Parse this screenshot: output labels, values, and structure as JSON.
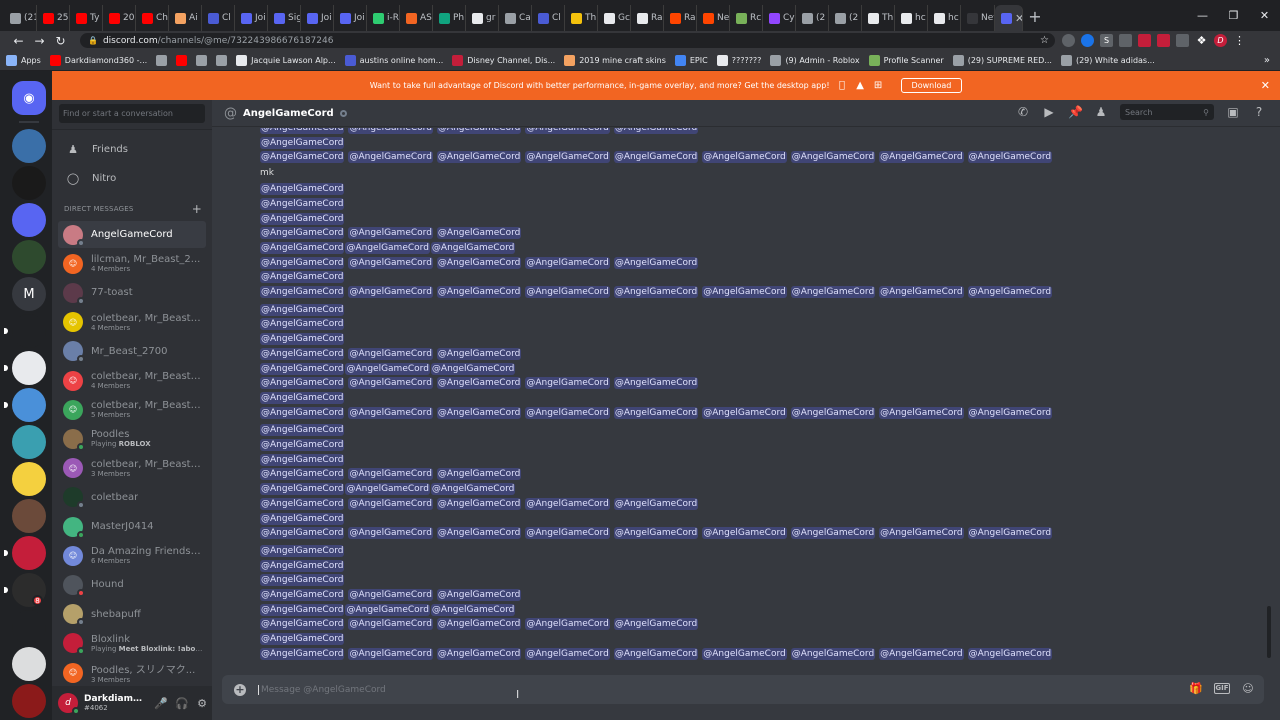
{
  "browser": {
    "tabs": [
      {
        "label": "(21",
        "color": "#9aa0a6"
      },
      {
        "label": "25",
        "color": "#ff0000"
      },
      {
        "label": "Ty",
        "color": "#ff0000"
      },
      {
        "label": "20",
        "color": "#ff0000"
      },
      {
        "label": "Ch",
        "color": "#ff0000"
      },
      {
        "label": "Ai",
        "color": "#f4a261"
      },
      {
        "label": "Cl",
        "color": "#4a5bd4"
      },
      {
        "label": "Joi",
        "color": "#5865f2"
      },
      {
        "label": "Sig",
        "color": "#5865f2"
      },
      {
        "label": "Joi",
        "color": "#5865f2"
      },
      {
        "label": "Joi",
        "color": "#5865f2"
      },
      {
        "label": "i-R",
        "color": "#2ecc71"
      },
      {
        "label": "AS",
        "color": "#f26522"
      },
      {
        "label": "Ph",
        "color": "#10a37f"
      },
      {
        "label": "gr",
        "color": "#e8eaed"
      },
      {
        "label": "Ca",
        "color": "#9aa0a6"
      },
      {
        "label": "Cl",
        "color": "#4a5bd4"
      },
      {
        "label": "Th",
        "color": "#f4c20d"
      },
      {
        "label": "Gc",
        "color": "#e8eaed"
      },
      {
        "label": "Ra",
        "color": "#e8eaed"
      },
      {
        "label": "Ra",
        "color": "#ff4500"
      },
      {
        "label": "Ne",
        "color": "#ff4500"
      },
      {
        "label": "Rc",
        "color": "#78b159"
      },
      {
        "label": "Cy",
        "color": "#9146ff"
      },
      {
        "label": "(2",
        "color": "#9aa0a6"
      },
      {
        "label": "(2",
        "color": "#9aa0a6"
      },
      {
        "label": "Th",
        "color": "#e8eaed"
      },
      {
        "label": "hc",
        "color": "#e8eaed"
      },
      {
        "label": "hc",
        "color": "#e8eaed"
      },
      {
        "label": "New T",
        "color": "#35363a"
      }
    ],
    "active_tab_color": "#5865f2",
    "url_host": "discord.com",
    "url_path": "/channels/@me/732243986676187246",
    "bookmarks": [
      {
        "label": "Apps",
        "color": "#8ab4f8"
      },
      {
        "label": "Darkdiamond360 -...",
        "color": "#ff0000"
      },
      {
        "label": "",
        "color": "#9aa0a6"
      },
      {
        "label": "",
        "color": "#ff0000"
      },
      {
        "label": "",
        "color": "#9aa0a6"
      },
      {
        "label": "",
        "color": "#9aa0a6"
      },
      {
        "label": "Jacquie Lawson Alp...",
        "color": "#e8eaed"
      },
      {
        "label": "austins online hom...",
        "color": "#4a5bd4"
      },
      {
        "label": "Disney Channel, Dis...",
        "color": "#c41e3a"
      },
      {
        "label": "2019 mine craft skins",
        "color": "#f4a261"
      },
      {
        "label": "EPIC",
        "color": "#4285f4"
      },
      {
        "label": "???????",
        "color": "#e8eaed"
      },
      {
        "label": "(9) Admin - Roblox",
        "color": "#9aa0a6"
      },
      {
        "label": "Profile Scanner",
        "color": "#78b159"
      },
      {
        "label": "(29) SUPREME RED...",
        "color": "#9aa0a6"
      },
      {
        "label": "(29) White adidas...",
        "color": "#9aa0a6"
      }
    ]
  },
  "banner": {
    "text": "Want to take full advantage of Discord with better performance, in-game overlay, and more? Get the desktop app!",
    "download_label": "Download",
    "color": "#f26522"
  },
  "sidebar": {
    "search_placeholder": "Find or start a conversation",
    "friends_label": "Friends",
    "nitro_label": "Nitro",
    "dm_header": "DIRECT MESSAGES",
    "dms": [
      {
        "name": "AngelGameCord",
        "sub": "",
        "avatar_color": "#c97b84",
        "status": "#747f8d",
        "selected": true
      },
      {
        "name": "lilcman, Mr_Beast_2...",
        "sub": "4 Members",
        "avatar_color": "#f26522",
        "status": "",
        "selected": false
      },
      {
        "name": "77-toast",
        "sub": "",
        "avatar_color": "#5c3a4a",
        "status": "#747f8d",
        "selected": false
      },
      {
        "name": "coletbear, Mr_Beast_...",
        "sub": "4 Members",
        "avatar_color": "#e5c400",
        "status": "",
        "selected": false
      },
      {
        "name": "Mr_Beast_2700",
        "sub": "",
        "avatar_color": "#6a7fa8",
        "status": "#747f8d",
        "selected": false
      },
      {
        "name": "coletbear, Mr_Beast_...",
        "sub": "4 Members",
        "avatar_color": "#ed4245",
        "status": "",
        "selected": false
      },
      {
        "name": "coletbear, Mr_Beast_...",
        "sub": "5 Members",
        "avatar_color": "#3ba55c",
        "status": "",
        "selected": false
      },
      {
        "name": "Poodles",
        "sub_prefix": "Playing ",
        "sub_bold": "ROBLOX",
        "avatar_color": "#8a6d4a",
        "status": "#3ba55c",
        "selected": false
      },
      {
        "name": "coletbear, Mr_Beast_...",
        "sub": "3 Members",
        "avatar_color": "#9b59b6",
        "status": "",
        "selected": false
      },
      {
        "name": "coletbear",
        "sub": "",
        "avatar_color": "#1e3b2a",
        "status": "#747f8d",
        "selected": false
      },
      {
        "name": "MasterJ0414",
        "sub": "",
        "avatar_color": "#43b581",
        "status": "#3ba55c",
        "selected": false
      },
      {
        "name": "Da Amazing Friends ...",
        "sub": "6 Members",
        "avatar_color": "#7289da",
        "status": "",
        "selected": false
      },
      {
        "name": "Hound",
        "sub": "",
        "avatar_color": "#4f545c",
        "status": "#ed4245",
        "selected": false
      },
      {
        "name": "shebapuff",
        "sub": "",
        "avatar_color": "#b5a06a",
        "status": "#747f8d",
        "selected": false
      },
      {
        "name": "Bloxlink",
        "sub_prefix": "Playing ",
        "sub_bold": "Meet Bloxlink: !about",
        "avatar_color": "#c41e3a",
        "status": "#3ba55c",
        "selected": false
      },
      {
        "name": "Poodles, スリノマク...",
        "sub": "3 Members",
        "avatar_color": "#f26522",
        "status": "",
        "selected": false
      }
    ]
  },
  "user": {
    "name": "Darkdiamon...",
    "tag": "#4062"
  },
  "servers": [
    {
      "label": "",
      "color": "#5865f2"
    },
    {
      "label": "",
      "color": "#3a6fa8"
    },
    {
      "label": "",
      "color": "#1a1a1a"
    },
    {
      "label": "",
      "color": "#5865f2"
    },
    {
      "label": "",
      "color": "#2e4a2e"
    },
    {
      "label": "M",
      "color": "#36393f"
    },
    {
      "label": "",
      "color": "#202225"
    },
    {
      "label": "",
      "color": "#e8eaed"
    },
    {
      "label": "",
      "color": "#4a90d9"
    },
    {
      "label": "",
      "color": "#3a9fb0"
    },
    {
      "label": "",
      "color": "#f4d03f"
    },
    {
      "label": "",
      "color": "#6b4a3a"
    },
    {
      "label": "",
      "color": "#c41e3a"
    },
    {
      "label": "",
      "color": "#2c2c2c"
    },
    {
      "label": "",
      "color": "#202225"
    },
    {
      "label": "",
      "color": "#dcddde"
    },
    {
      "label": "",
      "color": "#8b1a1a"
    }
  ],
  "server_badge": "8",
  "chat": {
    "recipient": "AngelGameCord",
    "search_placeholder": "Search",
    "mention_text": "@AngelGameCord",
    "plain_text": "mk",
    "message_placeholder": "Message @AngelGameCord",
    "lines": [
      {
        "type": "mention",
        "count": 5
      },
      {
        "type": "mention",
        "count": 1
      },
      {
        "type": "mention",
        "count": 9
      },
      {
        "type": "plain"
      },
      {
        "type": "mention",
        "count": 1
      },
      {
        "type": "mention",
        "count": 1
      },
      {
        "type": "mention",
        "count": 1
      },
      {
        "type": "mention",
        "count": 3
      },
      {
        "type": "mention",
        "count": 3,
        "tight": true
      },
      {
        "type": "mention",
        "count": 5
      },
      {
        "type": "mention",
        "count": 1
      },
      {
        "type": "mention",
        "count": 9
      },
      {
        "type": "gap"
      },
      {
        "type": "mention",
        "count": 1
      },
      {
        "type": "mention",
        "count": 1
      },
      {
        "type": "mention",
        "count": 1
      },
      {
        "type": "mention",
        "count": 3
      },
      {
        "type": "mention",
        "count": 3,
        "tight": true
      },
      {
        "type": "mention",
        "count": 5
      },
      {
        "type": "mention",
        "count": 1
      },
      {
        "type": "mention",
        "count": 9
      },
      {
        "type": "gap"
      },
      {
        "type": "mention",
        "count": 1
      },
      {
        "type": "mention",
        "count": 1
      },
      {
        "type": "mention",
        "count": 1
      },
      {
        "type": "mention",
        "count": 3
      },
      {
        "type": "mention",
        "count": 3,
        "tight": true
      },
      {
        "type": "mention",
        "count": 5
      },
      {
        "type": "mention",
        "count": 1
      },
      {
        "type": "mention",
        "count": 9
      },
      {
        "type": "gap"
      },
      {
        "type": "mention",
        "count": 1
      },
      {
        "type": "mention",
        "count": 1
      },
      {
        "type": "mention",
        "count": 1
      },
      {
        "type": "mention",
        "count": 3
      },
      {
        "type": "mention",
        "count": 3,
        "tight": true
      },
      {
        "type": "mention",
        "count": 5
      },
      {
        "type": "mention",
        "count": 1
      },
      {
        "type": "mention",
        "count": 9
      }
    ]
  },
  "icons": {
    "friends": "friends-icon",
    "nitro": "nitro-icon",
    "call": "call-icon",
    "video": "video-icon",
    "pin": "pin-icon",
    "add_member": "add-member-icon",
    "inbox": "inbox-icon",
    "help": "help-icon",
    "mute": "mute-icon",
    "deafen": "headphones-icon",
    "settings": "gear-icon",
    "gift": "gift-icon",
    "gif": "GIF",
    "emoji": "emoji-icon"
  }
}
